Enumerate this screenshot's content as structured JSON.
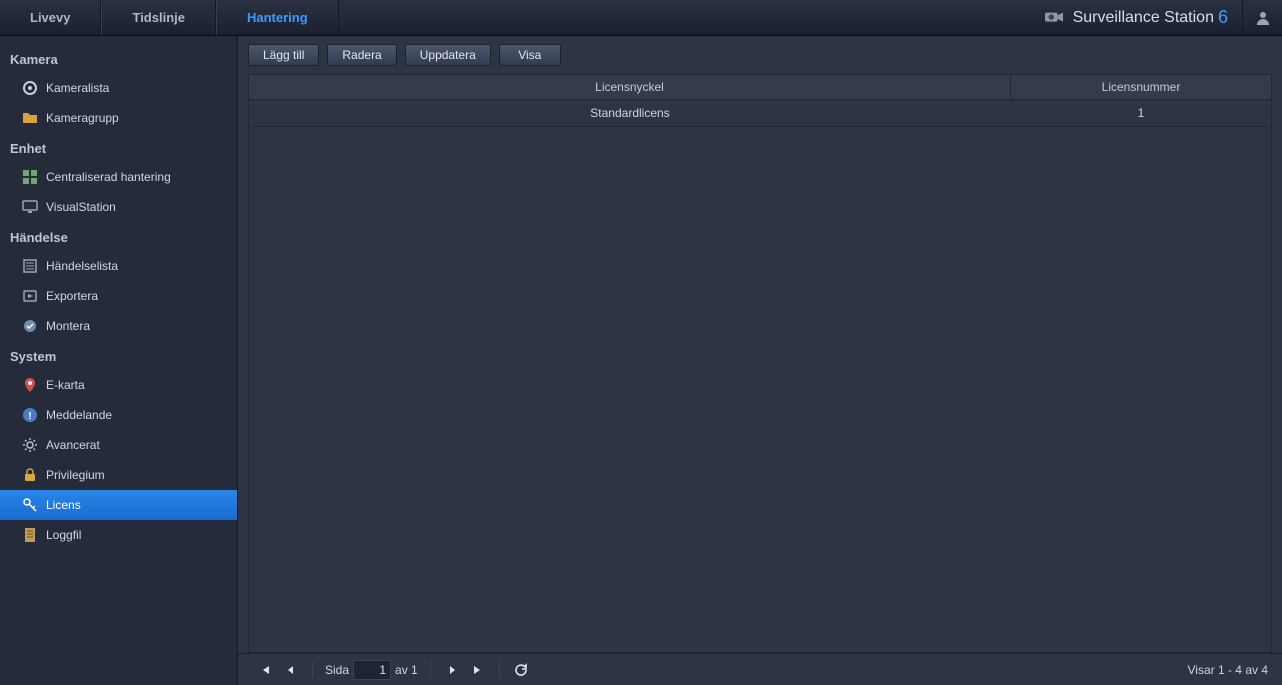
{
  "topnav": {
    "items": [
      {
        "label": "Livevy",
        "active": false
      },
      {
        "label": "Tidslinje",
        "active": false
      },
      {
        "label": "Hantering",
        "active": true
      }
    ]
  },
  "brand": {
    "name": "Surveillance Station",
    "version": "6"
  },
  "sidebar": {
    "groups": [
      {
        "title": "Kamera",
        "items": [
          {
            "label": "Kameralista",
            "icon": "camera-icon",
            "active": false
          },
          {
            "label": "Kameragrupp",
            "icon": "folder-icon",
            "active": false
          }
        ]
      },
      {
        "title": "Enhet",
        "items": [
          {
            "label": "Centraliserad hantering",
            "icon": "grid-icon",
            "active": false
          },
          {
            "label": "VisualStation",
            "icon": "monitor-icon",
            "active": false
          }
        ]
      },
      {
        "title": "Händelse",
        "items": [
          {
            "label": "Händelselista",
            "icon": "list-icon",
            "active": false
          },
          {
            "label": "Exportera",
            "icon": "export-icon",
            "active": false
          },
          {
            "label": "Montera",
            "icon": "mount-icon",
            "active": false
          }
        ]
      },
      {
        "title": "System",
        "items": [
          {
            "label": "E-karta",
            "icon": "map-pin-icon",
            "active": false
          },
          {
            "label": "Meddelande",
            "icon": "info-icon",
            "active": false
          },
          {
            "label": "Avancerat",
            "icon": "gear-icon",
            "active": false
          },
          {
            "label": "Privilegium",
            "icon": "lock-icon",
            "active": false
          },
          {
            "label": "Licens",
            "icon": "key-icon",
            "active": true
          },
          {
            "label": "Loggfil",
            "icon": "log-icon",
            "active": false
          }
        ]
      }
    ]
  },
  "toolbar": {
    "add": "Lägg till",
    "delete": "Radera",
    "update": "Uppdatera",
    "show": "Visa"
  },
  "table": {
    "columns": {
      "key": "Licensnyckel",
      "number": "Licensnummer"
    },
    "rows": [
      {
        "key": "Standardlicens",
        "number": "1"
      }
    ]
  },
  "pager": {
    "page_label": "Sida",
    "page_value": "1",
    "of_label": "av 1",
    "status": "Visar 1 - 4 av 4"
  }
}
